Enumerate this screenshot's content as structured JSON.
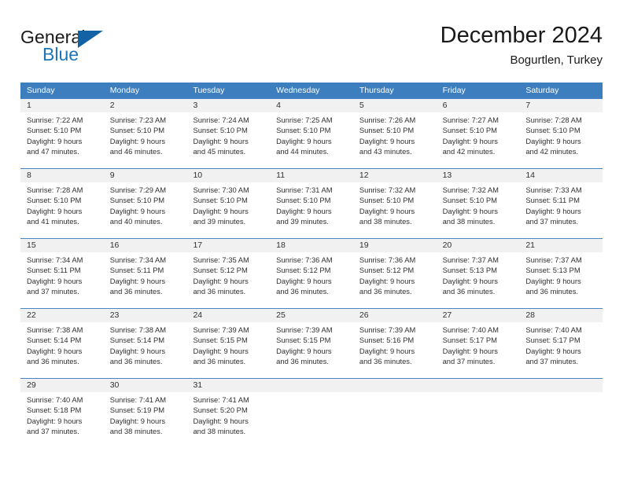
{
  "brand": {
    "name_part1": "General",
    "name_part2": "Blue",
    "triangle_color": "#1462a6",
    "blue_color": "#1b75bb"
  },
  "header": {
    "title": "December 2024",
    "subtitle": "Bogurtlen, Turkey"
  },
  "theme": {
    "header_blue": "#3d7ebf",
    "daynum_band": "#f1f1f1",
    "row_divider": "#4a86c5",
    "text": "#303030"
  },
  "weekdays": [
    "Sunday",
    "Monday",
    "Tuesday",
    "Wednesday",
    "Thursday",
    "Friday",
    "Saturday"
  ],
  "weeks": [
    [
      {
        "day": "1",
        "sunrise": "Sunrise: 7:22 AM",
        "sunset": "Sunset: 5:10 PM",
        "daylight1": "Daylight: 9 hours",
        "daylight2": "and 47 minutes."
      },
      {
        "day": "2",
        "sunrise": "Sunrise: 7:23 AM",
        "sunset": "Sunset: 5:10 PM",
        "daylight1": "Daylight: 9 hours",
        "daylight2": "and 46 minutes."
      },
      {
        "day": "3",
        "sunrise": "Sunrise: 7:24 AM",
        "sunset": "Sunset: 5:10 PM",
        "daylight1": "Daylight: 9 hours",
        "daylight2": "and 45 minutes."
      },
      {
        "day": "4",
        "sunrise": "Sunrise: 7:25 AM",
        "sunset": "Sunset: 5:10 PM",
        "daylight1": "Daylight: 9 hours",
        "daylight2": "and 44 minutes."
      },
      {
        "day": "5",
        "sunrise": "Sunrise: 7:26 AM",
        "sunset": "Sunset: 5:10 PM",
        "daylight1": "Daylight: 9 hours",
        "daylight2": "and 43 minutes."
      },
      {
        "day": "6",
        "sunrise": "Sunrise: 7:27 AM",
        "sunset": "Sunset: 5:10 PM",
        "daylight1": "Daylight: 9 hours",
        "daylight2": "and 42 minutes."
      },
      {
        "day": "7",
        "sunrise": "Sunrise: 7:28 AM",
        "sunset": "Sunset: 5:10 PM",
        "daylight1": "Daylight: 9 hours",
        "daylight2": "and 42 minutes."
      }
    ],
    [
      {
        "day": "8",
        "sunrise": "Sunrise: 7:28 AM",
        "sunset": "Sunset: 5:10 PM",
        "daylight1": "Daylight: 9 hours",
        "daylight2": "and 41 minutes."
      },
      {
        "day": "9",
        "sunrise": "Sunrise: 7:29 AM",
        "sunset": "Sunset: 5:10 PM",
        "daylight1": "Daylight: 9 hours",
        "daylight2": "and 40 minutes."
      },
      {
        "day": "10",
        "sunrise": "Sunrise: 7:30 AM",
        "sunset": "Sunset: 5:10 PM",
        "daylight1": "Daylight: 9 hours",
        "daylight2": "and 39 minutes."
      },
      {
        "day": "11",
        "sunrise": "Sunrise: 7:31 AM",
        "sunset": "Sunset: 5:10 PM",
        "daylight1": "Daylight: 9 hours",
        "daylight2": "and 39 minutes."
      },
      {
        "day": "12",
        "sunrise": "Sunrise: 7:32 AM",
        "sunset": "Sunset: 5:10 PM",
        "daylight1": "Daylight: 9 hours",
        "daylight2": "and 38 minutes."
      },
      {
        "day": "13",
        "sunrise": "Sunrise: 7:32 AM",
        "sunset": "Sunset: 5:10 PM",
        "daylight1": "Daylight: 9 hours",
        "daylight2": "and 38 minutes."
      },
      {
        "day": "14",
        "sunrise": "Sunrise: 7:33 AM",
        "sunset": "Sunset: 5:11 PM",
        "daylight1": "Daylight: 9 hours",
        "daylight2": "and 37 minutes."
      }
    ],
    [
      {
        "day": "15",
        "sunrise": "Sunrise: 7:34 AM",
        "sunset": "Sunset: 5:11 PM",
        "daylight1": "Daylight: 9 hours",
        "daylight2": "and 37 minutes."
      },
      {
        "day": "16",
        "sunrise": "Sunrise: 7:34 AM",
        "sunset": "Sunset: 5:11 PM",
        "daylight1": "Daylight: 9 hours",
        "daylight2": "and 36 minutes."
      },
      {
        "day": "17",
        "sunrise": "Sunrise: 7:35 AM",
        "sunset": "Sunset: 5:12 PM",
        "daylight1": "Daylight: 9 hours",
        "daylight2": "and 36 minutes."
      },
      {
        "day": "18",
        "sunrise": "Sunrise: 7:36 AM",
        "sunset": "Sunset: 5:12 PM",
        "daylight1": "Daylight: 9 hours",
        "daylight2": "and 36 minutes."
      },
      {
        "day": "19",
        "sunrise": "Sunrise: 7:36 AM",
        "sunset": "Sunset: 5:12 PM",
        "daylight1": "Daylight: 9 hours",
        "daylight2": "and 36 minutes."
      },
      {
        "day": "20",
        "sunrise": "Sunrise: 7:37 AM",
        "sunset": "Sunset: 5:13 PM",
        "daylight1": "Daylight: 9 hours",
        "daylight2": "and 36 minutes."
      },
      {
        "day": "21",
        "sunrise": "Sunrise: 7:37 AM",
        "sunset": "Sunset: 5:13 PM",
        "daylight1": "Daylight: 9 hours",
        "daylight2": "and 36 minutes."
      }
    ],
    [
      {
        "day": "22",
        "sunrise": "Sunrise: 7:38 AM",
        "sunset": "Sunset: 5:14 PM",
        "daylight1": "Daylight: 9 hours",
        "daylight2": "and 36 minutes."
      },
      {
        "day": "23",
        "sunrise": "Sunrise: 7:38 AM",
        "sunset": "Sunset: 5:14 PM",
        "daylight1": "Daylight: 9 hours",
        "daylight2": "and 36 minutes."
      },
      {
        "day": "24",
        "sunrise": "Sunrise: 7:39 AM",
        "sunset": "Sunset: 5:15 PM",
        "daylight1": "Daylight: 9 hours",
        "daylight2": "and 36 minutes."
      },
      {
        "day": "25",
        "sunrise": "Sunrise: 7:39 AM",
        "sunset": "Sunset: 5:15 PM",
        "daylight1": "Daylight: 9 hours",
        "daylight2": "and 36 minutes."
      },
      {
        "day": "26",
        "sunrise": "Sunrise: 7:39 AM",
        "sunset": "Sunset: 5:16 PM",
        "daylight1": "Daylight: 9 hours",
        "daylight2": "and 36 minutes."
      },
      {
        "day": "27",
        "sunrise": "Sunrise: 7:40 AM",
        "sunset": "Sunset: 5:17 PM",
        "daylight1": "Daylight: 9 hours",
        "daylight2": "and 37 minutes."
      },
      {
        "day": "28",
        "sunrise": "Sunrise: 7:40 AM",
        "sunset": "Sunset: 5:17 PM",
        "daylight1": "Daylight: 9 hours",
        "daylight2": "and 37 minutes."
      }
    ],
    [
      {
        "day": "29",
        "sunrise": "Sunrise: 7:40 AM",
        "sunset": "Sunset: 5:18 PM",
        "daylight1": "Daylight: 9 hours",
        "daylight2": "and 37 minutes."
      },
      {
        "day": "30",
        "sunrise": "Sunrise: 7:41 AM",
        "sunset": "Sunset: 5:19 PM",
        "daylight1": "Daylight: 9 hours",
        "daylight2": "and 38 minutes."
      },
      {
        "day": "31",
        "sunrise": "Sunrise: 7:41 AM",
        "sunset": "Sunset: 5:20 PM",
        "daylight1": "Daylight: 9 hours",
        "daylight2": "and 38 minutes."
      },
      {
        "day": "",
        "sunrise": "",
        "sunset": "",
        "daylight1": "",
        "daylight2": ""
      },
      {
        "day": "",
        "sunrise": "",
        "sunset": "",
        "daylight1": "",
        "daylight2": ""
      },
      {
        "day": "",
        "sunrise": "",
        "sunset": "",
        "daylight1": "",
        "daylight2": ""
      },
      {
        "day": "",
        "sunrise": "",
        "sunset": "",
        "daylight1": "",
        "daylight2": ""
      }
    ]
  ]
}
